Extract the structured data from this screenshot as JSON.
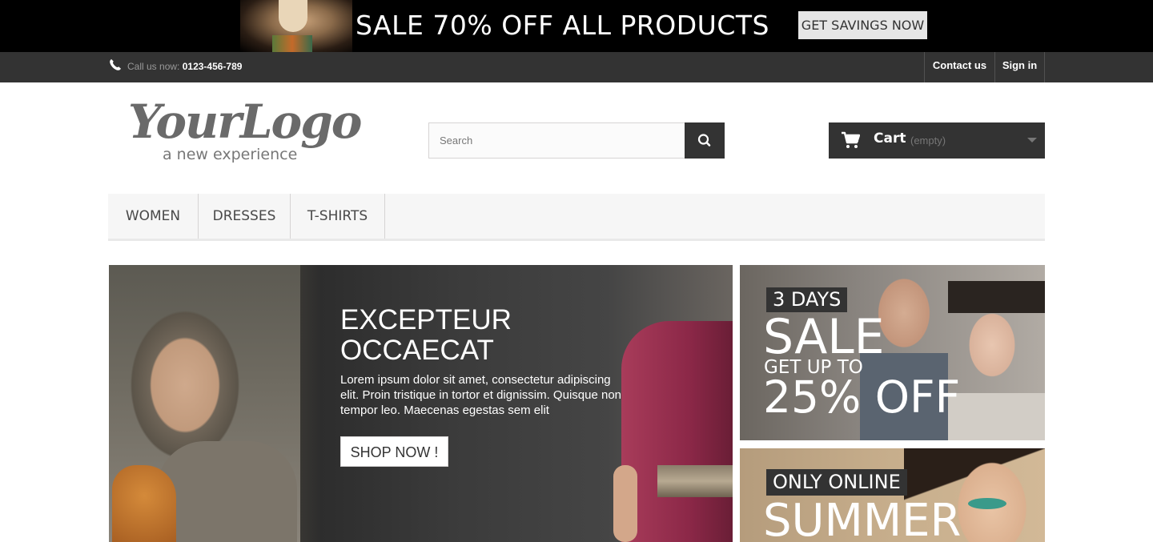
{
  "promo": {
    "headline": "SALE 70% OFF ALL PRODUCTS",
    "button_label": "GET SAVINGS NOW"
  },
  "topbar": {
    "call_label": "Call us now:",
    "phone_number": "0123-456-789",
    "contact_label": "Contact us",
    "signin_label": "Sign in"
  },
  "header": {
    "logo_script": "YourLogo",
    "logo_tagline": "a new experience",
    "search_placeholder": "Search",
    "cart_label": "Cart",
    "cart_status": "(empty)"
  },
  "menu": {
    "items": [
      {
        "label": "WOMEN"
      },
      {
        "label": "DRESSES"
      },
      {
        "label": "T-SHIRTS"
      }
    ]
  },
  "hero": {
    "title": "EXCEPTEUR\nOCCAECAT",
    "text": "Lorem ipsum dolor sit amet, consectetur adipiscing elit. Proin tristique in tortor et dignissim. Quisque non tempor leo. Maecenas egestas sem elit",
    "button_label": "SHOP NOW !"
  },
  "banners": {
    "first": {
      "tag": "3 DAYS",
      "headline": "SALE",
      "subline": "GET UP TO",
      "offer": "25% OFF"
    },
    "second": {
      "tag": "ONLY ONLINE",
      "headline": "SUMMER"
    }
  },
  "colors": {
    "dark": "#333333",
    "menu_bg": "#f6f6f6",
    "promo_bg": "#000000"
  }
}
